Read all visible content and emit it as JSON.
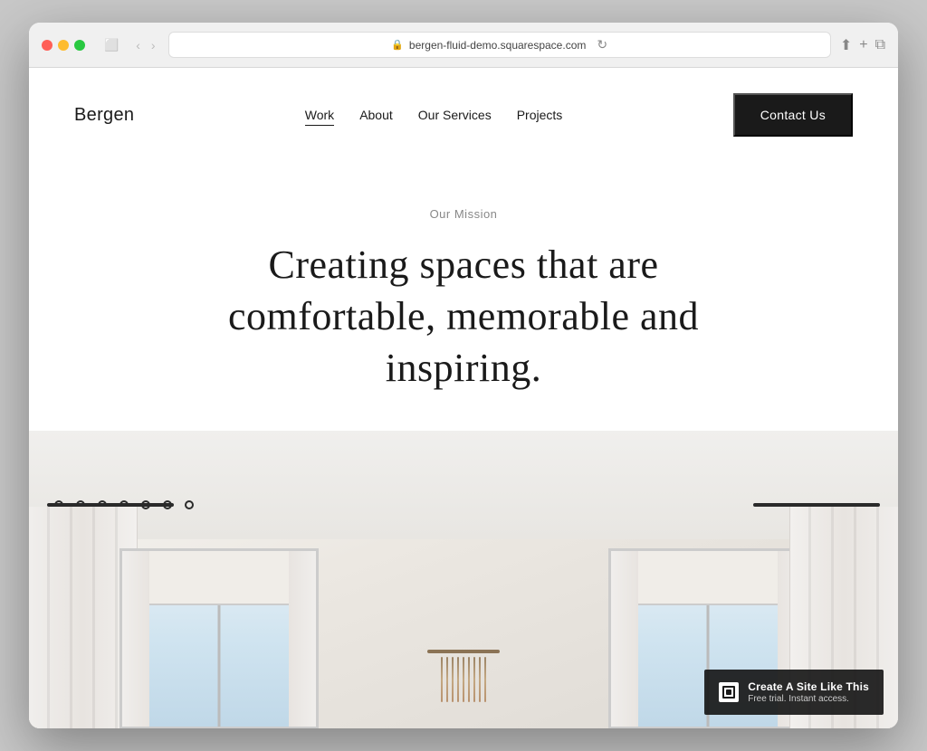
{
  "browser": {
    "url": "bergen-fluid-demo.squarespace.com",
    "dots": [
      "red",
      "yellow",
      "green"
    ]
  },
  "site": {
    "logo": "Bergen",
    "nav": {
      "links": [
        {
          "label": "Work",
          "active": true
        },
        {
          "label": "About",
          "active": false
        },
        {
          "label": "Our Services",
          "active": false
        },
        {
          "label": "Projects",
          "active": false
        }
      ],
      "cta_label": "Contact Us"
    },
    "hero": {
      "mission_label": "Our Mission",
      "headline": "Creating spaces that are comfortable, memorable and inspiring."
    },
    "badge": {
      "title": "Create A Site Like This",
      "subtitle": "Free trial. Instant access."
    }
  }
}
